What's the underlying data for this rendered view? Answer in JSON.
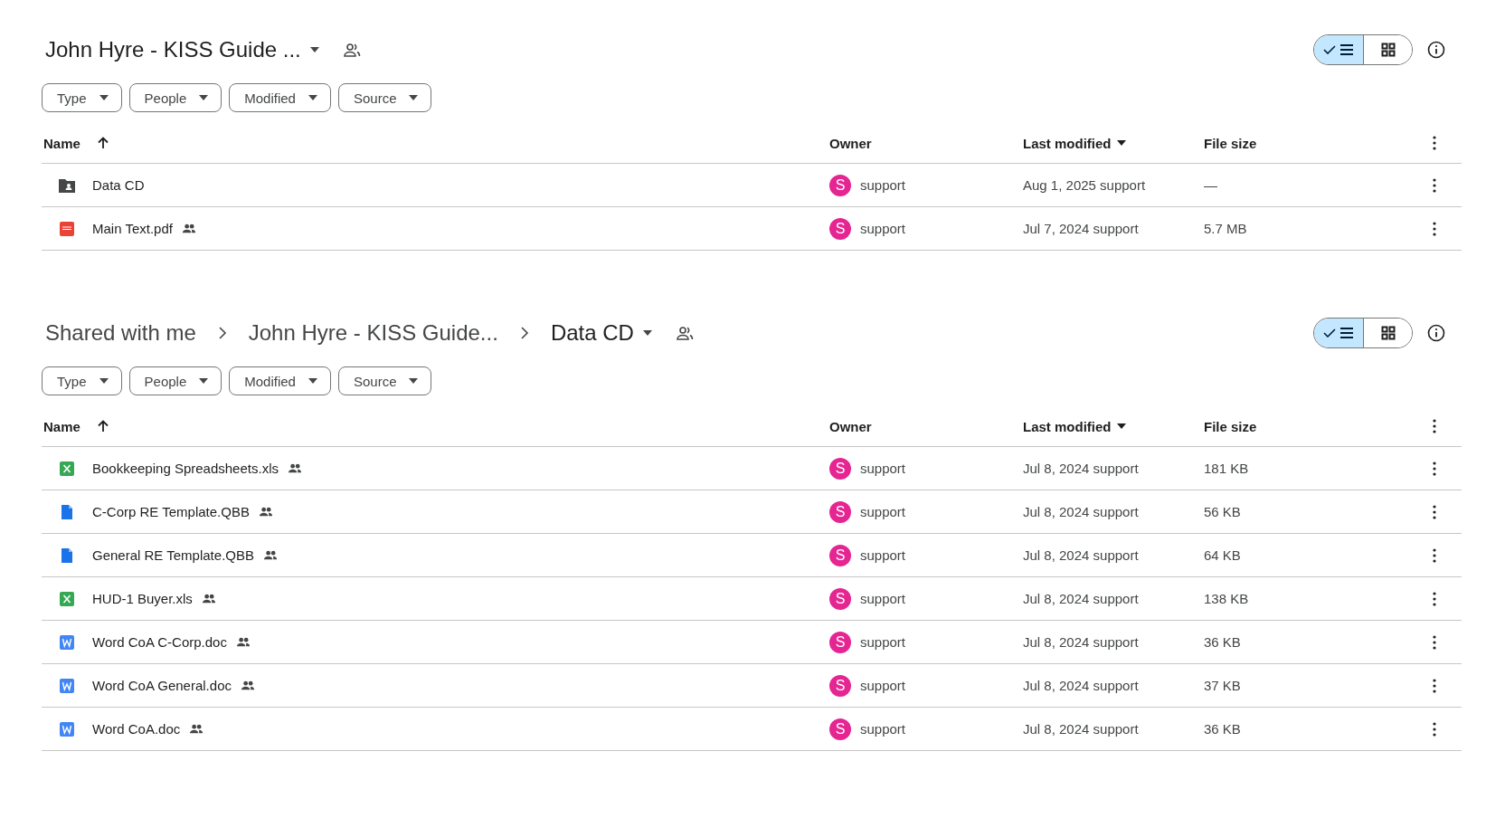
{
  "panels": [
    {
      "breadcrumbs": [
        {
          "label": "John Hyre - KISS Guide ...",
          "current": true,
          "dropdown": true
        }
      ],
      "shared": true,
      "view_toggle": [
        {
          "kind": "list",
          "selected": true
        },
        {
          "kind": "grid",
          "selected": false
        }
      ],
      "filters": [
        "Type",
        "People",
        "Modified",
        "Source"
      ],
      "columns": [
        {
          "label": "Name",
          "sorted": true,
          "ascending": true
        },
        {
          "label": "Owner"
        },
        {
          "label": "Last modified",
          "sorted": true,
          "ascending": false
        },
        {
          "label": "File size"
        }
      ],
      "rows": [
        {
          "kind": "folder",
          "name": "Data CD",
          "shared": false,
          "owner": {
            "initial": "S",
            "name": "support"
          },
          "modified": "Aug 1, 2025 support",
          "size": "—"
        },
        {
          "kind": "pdf",
          "name": "Main Text.pdf",
          "shared": true,
          "owner": {
            "initial": "S",
            "name": "support"
          },
          "modified": "Jul 7, 2024 support",
          "size": "5.7 MB"
        }
      ]
    },
    {
      "breadcrumbs": [
        {
          "label": "Shared with me",
          "current": false,
          "dropdown": false
        },
        {
          "label": "John Hyre - KISS Guide...",
          "current": false,
          "dropdown": false
        },
        {
          "label": "Data CD",
          "current": true,
          "dropdown": true
        }
      ],
      "shared": true,
      "view_toggle": [
        {
          "kind": "list",
          "selected": true
        },
        {
          "kind": "grid",
          "selected": false
        }
      ],
      "filters": [
        "Type",
        "People",
        "Modified",
        "Source"
      ],
      "columns": [
        {
          "label": "Name",
          "sorted": true,
          "ascending": true
        },
        {
          "label": "Owner"
        },
        {
          "label": "Last modified",
          "sorted": true,
          "ascending": false
        },
        {
          "label": "File size"
        }
      ],
      "rows": [
        {
          "kind": "xls",
          "name": "Bookkeeping Spreadsheets.xls",
          "shared": true,
          "owner": {
            "initial": "S",
            "name": "support"
          },
          "modified": "Jul 8, 2024 support",
          "size": "181 KB"
        },
        {
          "kind": "file",
          "name": "C-Corp RE Template.QBB",
          "shared": true,
          "owner": {
            "initial": "S",
            "name": "support"
          },
          "modified": "Jul 8, 2024 support",
          "size": "56 KB"
        },
        {
          "kind": "file",
          "name": "General RE Template.QBB",
          "shared": true,
          "owner": {
            "initial": "S",
            "name": "support"
          },
          "modified": "Jul 8, 2024 support",
          "size": "64 KB"
        },
        {
          "kind": "xls",
          "name": "HUD-1 Buyer.xls",
          "shared": true,
          "owner": {
            "initial": "S",
            "name": "support"
          },
          "modified": "Jul 8, 2024 support",
          "size": "138 KB"
        },
        {
          "kind": "doc",
          "name": "Word CoA C-Corp.doc",
          "shared": true,
          "owner": {
            "initial": "S",
            "name": "support"
          },
          "modified": "Jul 8, 2024 support",
          "size": "36 KB"
        },
        {
          "kind": "doc",
          "name": "Word CoA General.doc",
          "shared": true,
          "owner": {
            "initial": "S",
            "name": "support"
          },
          "modified": "Jul 8, 2024 support",
          "size": "37 KB"
        },
        {
          "kind": "doc",
          "name": "Word CoA.doc",
          "shared": true,
          "owner": {
            "initial": "S",
            "name": "support"
          },
          "modified": "Jul 8, 2024 support",
          "size": "36 KB"
        }
      ]
    }
  ]
}
